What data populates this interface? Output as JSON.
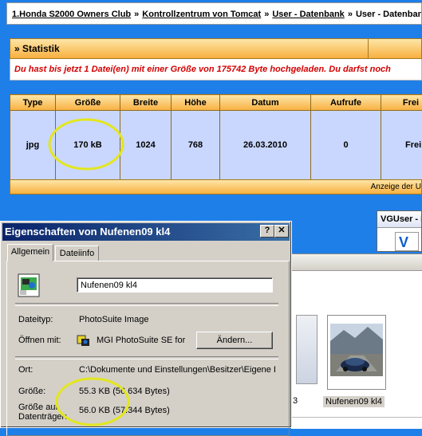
{
  "breadcrumb": {
    "items": [
      "1.Honda S2000 Owners Club",
      "Kontrollzentrum von Tomcat",
      "User - Datenbank",
      "User - Datenbank B"
    ],
    "separator": "»"
  },
  "statistik": {
    "header": "» Statistik",
    "message": "Du hast bis jetzt 1 Datei(en) mit einer Größe von 175742 Byte hochgeladen. Du darfst noch"
  },
  "files_table": {
    "headers": [
      "Type",
      "Größe",
      "Breite",
      "Höhe",
      "Datum",
      "Aufrufe",
      "Frei"
    ],
    "rows": [
      [
        "jpg",
        "170 kB",
        "1024",
        "768",
        "26.03.2010",
        "0",
        "Frei"
      ]
    ],
    "footer": "Anzeige der U"
  },
  "vguser": {
    "title": "VGUser - Da",
    "inner": "V"
  },
  "explorer": {
    "left_caption": "3",
    "selected_caption": "Nufenen09 kl4"
  },
  "dialog": {
    "title": "Eigenschaften von Nufenen09 kl4",
    "help_btn": "?",
    "close_btn": "✕",
    "tabs": [
      "Allgemein",
      "Dateiinfo"
    ],
    "file_name": "Nufenen09 kl4",
    "rows": {
      "dateityp_label": "Dateityp:",
      "dateityp_value": "PhotoSuite Image",
      "oeffnen_label": "Öffnen mit:",
      "oeffnen_value": "MGI PhotoSuite SE for",
      "change_button": "Ändern...",
      "ort_label": "Ort:",
      "ort_value": "C:\\Dokumente und Einstellungen\\Besitzer\\Eigene D",
      "groesse_label": "Größe:",
      "groesse_value": "55.3 KB (56.634 Bytes)",
      "gd_label_1": "Größe auf",
      "gd_label_2": "Datenträger:",
      "gd_value": "56.0 KB (57.344 Bytes)"
    }
  },
  "colors": {
    "page_bg": "#1f7fe8",
    "header_orange": "#f8b040",
    "cell_blue": "#c9d7ff",
    "warning_red": "#d40000",
    "annotation_yellow": "#e3e61e",
    "dialog_title": "#0a246a"
  }
}
